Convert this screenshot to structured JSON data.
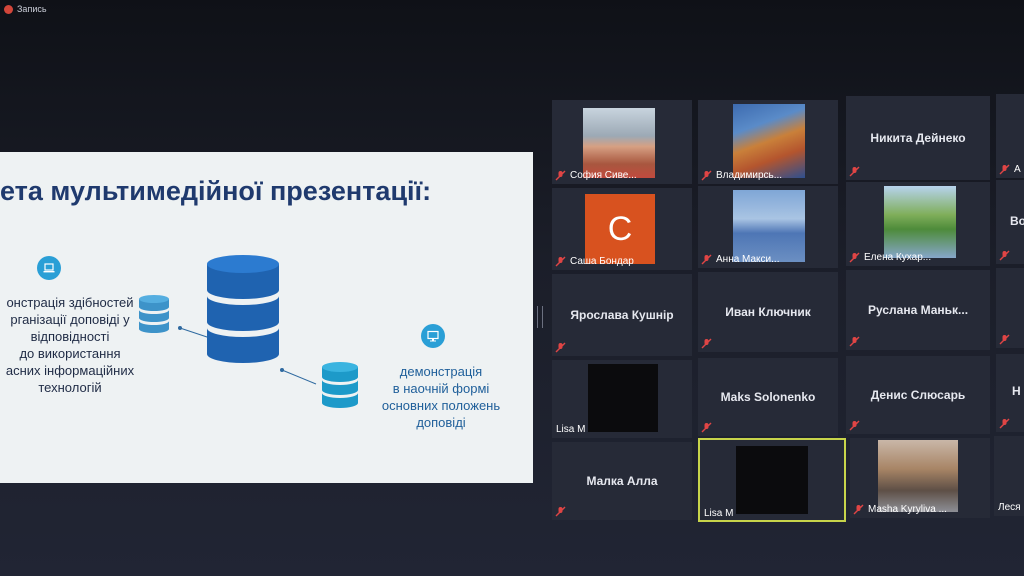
{
  "recording": {
    "label": "Запись"
  },
  "slide": {
    "title": "ета мультимедійної презентації:",
    "left_text": "онстрація здібностей\nрганізації доповіді у\nвідповідності\nдо використання\nасних інформаційних\nтехнологій",
    "right_text": "демонстрація\nв наочній формі\nосновних положень\nдоповіді",
    "accent_color": "#2a9fd6",
    "title_color": "#1f3a6e",
    "icons": [
      "laptop-icon",
      "monitor-icon"
    ]
  },
  "participants": [
    {
      "id": "sofia",
      "name": "София Сиве..."
    },
    {
      "id": "vladimir",
      "name": "Владимирсь..."
    },
    {
      "id": "nikita",
      "name": "Никита Дейнеко"
    },
    {
      "id": "edge1",
      "name": "А"
    },
    {
      "id": "sasha",
      "name": "Саша Бондар",
      "letter": "С"
    },
    {
      "id": "anna",
      "name": "Анна Макси..."
    },
    {
      "id": "elena",
      "name": "Елена Кухар..."
    },
    {
      "id": "edge2",
      "name": "Во"
    },
    {
      "id": "yaroslava",
      "name": "Ярослава Кушнір"
    },
    {
      "id": "ivan",
      "name": "Иван Ключник"
    },
    {
      "id": "ruslana",
      "name": "Руслана  Маньк..."
    },
    {
      "id": "lisa1",
      "name": "Lisa M"
    },
    {
      "id": "maks",
      "name": "Maks Solonenko"
    },
    {
      "id": "denis",
      "name": "Денис Слюсарь"
    },
    {
      "id": "edge3",
      "name": "Н"
    },
    {
      "id": "malka",
      "name": "Малка Алла"
    },
    {
      "id": "lisa2",
      "name": "Lisa M"
    },
    {
      "id": "masha",
      "name": "Masha Kyryliva ..."
    },
    {
      "id": "edge4",
      "name": "Леся"
    }
  ]
}
